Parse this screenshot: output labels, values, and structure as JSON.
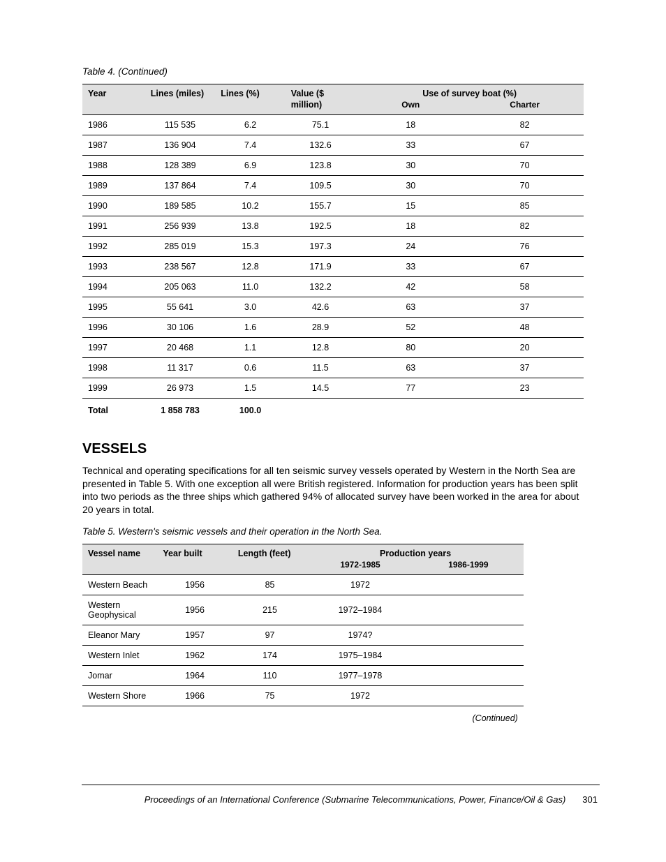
{
  "table1": {
    "caption": "Table 4. (Continued)",
    "headers": {
      "year": "Year",
      "lines_miles": "Lines (miles)",
      "lines_pct": "Lines (%)",
      "value_m": "Value ($ million)",
      "group": "Use of survey boat (%)",
      "sub_own": "Own",
      "sub_charter": "Charter"
    },
    "rows": [
      {
        "year": "1986",
        "miles": "115 535",
        "pct": "6.2",
        "value": "75.1",
        "own": "18",
        "charter": "82"
      },
      {
        "year": "1987",
        "miles": "136 904",
        "pct": "7.4",
        "value": "132.6",
        "own": "33",
        "charter": "67"
      },
      {
        "year": "1988",
        "miles": "128 389",
        "pct": "6.9",
        "value": "123.8",
        "own": "30",
        "charter": "70"
      },
      {
        "year": "1989",
        "miles": "137 864",
        "pct": "7.4",
        "value": "109.5",
        "own": "30",
        "charter": "70"
      },
      {
        "year": "1990",
        "miles": "189 585",
        "pct": "10.2",
        "value": "155.7",
        "own": "15",
        "charter": "85"
      },
      {
        "year": "1991",
        "miles": "256 939",
        "pct": "13.8",
        "value": "192.5",
        "own": "18",
        "charter": "82"
      },
      {
        "year": "1992",
        "miles": "285 019",
        "pct": "15.3",
        "value": "197.3",
        "own": "24",
        "charter": "76"
      },
      {
        "year": "1993",
        "miles": "238 567",
        "pct": "12.8",
        "value": "171.9",
        "own": "33",
        "charter": "67"
      },
      {
        "year": "1994",
        "miles": "205 063",
        "pct": "11.0",
        "value": "132.2",
        "own": "42",
        "charter": "58"
      },
      {
        "year": "1995",
        "miles": "55 641",
        "pct": "3.0",
        "value": "42.6",
        "own": "63",
        "charter": "37"
      },
      {
        "year": "1996",
        "miles": "30 106",
        "pct": "1.6",
        "value": "28.9",
        "own": "52",
        "charter": "48"
      },
      {
        "year": "1997",
        "miles": "20 468",
        "pct": "1.1",
        "value": "12.8",
        "own": "80",
        "charter": "20"
      },
      {
        "year": "1998",
        "miles": "11 317",
        "pct": "0.6",
        "value": "11.5",
        "own": "63",
        "charter": "37"
      },
      {
        "year": "1999",
        "miles": "26 973",
        "pct": "1.5",
        "value": "14.5",
        "own": "77",
        "charter": "23"
      }
    ],
    "total": {
      "label": "Total",
      "miles": "1 858 783",
      "pct": "100.0",
      "value": "",
      "own": "",
      "charter": ""
    }
  },
  "section": {
    "title": "VESSELS",
    "para": "Technical and operating specifications for all ten seismic survey vessels operated by Western in the North Sea are presented in Table 5. With one exception all were British registered. Information for production years has been split into two periods as the three ships which gathered 94% of allocated survey have been worked in the area for about 20 years in total."
  },
  "table2": {
    "caption": "Table 5. Western's seismic vessels and their operation in the North Sea.",
    "headers": {
      "name": "Vessel name",
      "built": "Year built",
      "length": "Length (feet)",
      "group": "Production years",
      "sub_7285": "1972-1985",
      "sub_8699": "1986-1999"
    },
    "rows": [
      {
        "name": "Western Beach",
        "built": "1956",
        "length": "85",
        "a": "1972",
        "b": ""
      },
      {
        "name": "Western Geophysical",
        "built": "1956",
        "length": "215",
        "a": "1972–1984",
        "b": ""
      },
      {
        "name": "Eleanor Mary",
        "built": "1957",
        "length": "97",
        "a": "1974?",
        "b": ""
      },
      {
        "name": "Western Inlet",
        "built": "1962",
        "length": "174",
        "a": "1975–1984",
        "b": ""
      },
      {
        "name": "Jomar",
        "built": "1964",
        "length": "110",
        "a": "1977–1978",
        "b": ""
      },
      {
        "name": "Western Shore",
        "built": "1966",
        "length": "75",
        "a": "1972",
        "b": ""
      }
    ],
    "continued": "(Continued)"
  },
  "footer": {
    "text": "Proceedings of an International Conference (Submarine Telecommunications, Power, Finance/Oil & Gas)",
    "page": "301"
  }
}
